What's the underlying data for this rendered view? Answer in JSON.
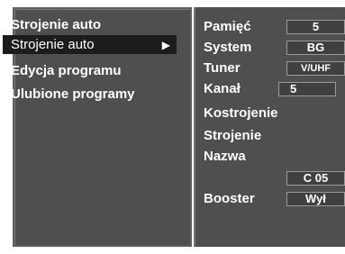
{
  "left_menu": {
    "items": [
      {
        "label": "Strojenie auto"
      },
      {
        "label": "Strojenie auto",
        "arrow": "▶"
      },
      {
        "label": "Edycja programu"
      },
      {
        "label": "Ulubione programy"
      }
    ]
  },
  "right_panel": {
    "params": [
      {
        "label": "Pamięć",
        "value": "5"
      },
      {
        "label": "System",
        "value": "BG"
      },
      {
        "label": "Tuner",
        "value": "V/UHF"
      },
      {
        "label": "Kanał",
        "value": "5"
      },
      {
        "label": "Kostrojenie"
      },
      {
        "label": "Strojenie"
      },
      {
        "label": "Nazwa",
        "value": "C 05"
      },
      {
        "label": "Booster",
        "value": "Wył"
      }
    ]
  },
  "colors": {
    "panel": "#4f4f4f",
    "selected": "#1c1c1c",
    "text": "#ffffff"
  }
}
